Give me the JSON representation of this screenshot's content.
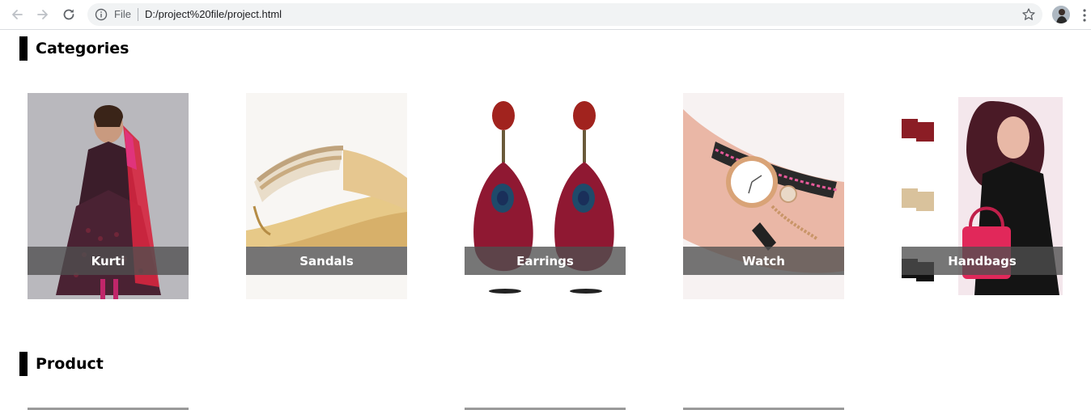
{
  "browser": {
    "scheme_label": "File",
    "url": "D:/project%20file/project.html",
    "icons": [
      "back-arrow-icon",
      "forward-arrow-icon",
      "reload-icon",
      "info-icon",
      "star-icon",
      "menu-icon"
    ]
  },
  "sections": {
    "categories": {
      "title": "Categories"
    },
    "product": {
      "title": "Product"
    }
  },
  "categories": [
    {
      "label": "Kurti"
    },
    {
      "label": "Sandals"
    },
    {
      "label": "Earrings"
    },
    {
      "label": "Watch"
    },
    {
      "label": "Handbags"
    }
  ],
  "colors": {
    "caption_overlay": "#505050",
    "heading_bar": "#000000",
    "omnibox_bg": "#f1f3f4"
  }
}
